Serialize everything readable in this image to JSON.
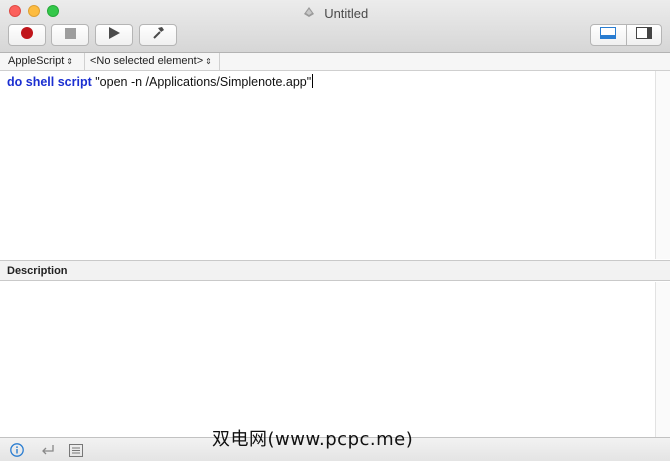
{
  "window": {
    "title": "Untitled"
  },
  "toolbar": {
    "record_icon": "record-icon",
    "stop_icon": "stop-icon",
    "run_icon": "play-icon",
    "compile_icon": "hammer-icon",
    "view_toggle": [
      "bottom-pane-icon",
      "side-pane-icon"
    ],
    "record_color": "#c0151a"
  },
  "navigation": {
    "language": "AppleScript",
    "element": "<No selected element>"
  },
  "editor": {
    "tokens": [
      {
        "text": "do shell script",
        "kind": "keyword"
      },
      {
        "text": " \"open -n /Applications/Simplenote.app\"",
        "kind": "string"
      }
    ]
  },
  "description": {
    "label": "Description",
    "text": ""
  },
  "bottombar": {
    "icons": [
      "info-icon",
      "return-icon",
      "list-icon"
    ],
    "accent": "#2a7dd1"
  },
  "watermark": "双电网(www.pcpc.me)"
}
